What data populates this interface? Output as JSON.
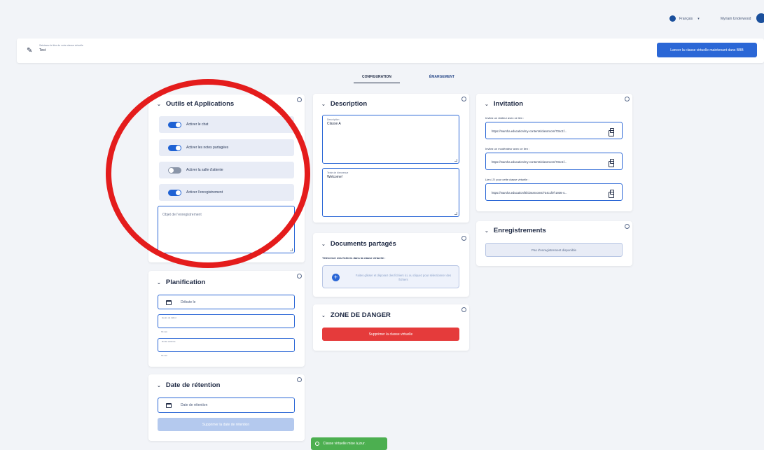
{
  "header": {
    "language": "Français",
    "username": "Myriam Underwood"
  },
  "titlebar": {
    "label": "Saisissez le titre de votre classe virtuelle",
    "value": "Test",
    "launch_button": "Lancer la classe virtuelle maintenant dans BBB"
  },
  "tabs": [
    "CONFIGURATION",
    "ÉMARGEMENT"
  ],
  "tools": {
    "title": "Outils et Applications",
    "toggles": [
      {
        "label": "Activer le chat",
        "on": true
      },
      {
        "label": "Activer les notes partagées",
        "on": true
      },
      {
        "label": "Activer la salle d'attente",
        "on": false
      },
      {
        "label": "Activer l'enregistrement",
        "on": true
      }
    ],
    "recording_placeholder": "Objet de l'enregistrement"
  },
  "planification": {
    "title": "Planification",
    "start_placeholder": "Débute le",
    "start_time_label": "Heure de début",
    "start_time_hint": "hh:mm",
    "duration_label": "Durée estimée",
    "duration_hint": "hh:mm"
  },
  "retention": {
    "title": "Date de rétention",
    "date_placeholder": "Date de rétention",
    "delete_button": "Supprimer la date de rétention"
  },
  "description": {
    "title": "Description",
    "desc_label": "Description",
    "desc_value": "Classe A",
    "welcome_label": "Texte de bienvenue",
    "welcome_value": "Welcome!"
  },
  "documents": {
    "title": "Documents partagés",
    "subtitle": "Téléverser des fichiers dans la classe virtuelle :",
    "drop_text": "Faites glisser et déposez des fichiers ici, ou cliquez pour sélectionner des fichiers"
  },
  "danger": {
    "title": "ZONE DE DANGER",
    "delete_button": "Supprimer la classe virtuelle"
  },
  "invitation": {
    "title": "Invitation",
    "links": [
      {
        "label": "Invitez un visiteur avec ce lien :",
        "url": "https://marsha.education/my-contents/classroom/734c1f..."
      },
      {
        "label": "Invitez un modérateur avec ce lien :",
        "url": "https://marsha.education/my-contents/classroom/734c1f..."
      },
      {
        "label": "Lien LTI pour cette classe virtuelle :",
        "url": "https://marsha.education/lti/classrooms/734c1f0f-1936-4..."
      }
    ]
  },
  "recordings": {
    "title": "Enregistrements",
    "empty": "Pas d'enregistrement disponible"
  },
  "toast": {
    "message": "Classe virtuelle mise à jour."
  },
  "colors": {
    "accent": "#2b67d6",
    "danger": "#e53b3b",
    "success": "#4caf50",
    "highlight": "#e41c1c"
  }
}
